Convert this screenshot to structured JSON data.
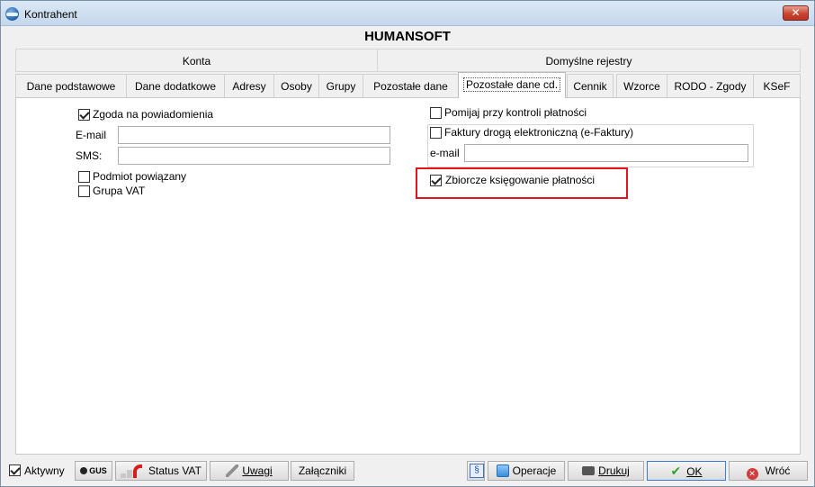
{
  "window": {
    "title": "Kontrahent",
    "close_label": "✕"
  },
  "company_name": "HUMANSOFT",
  "group_tabs": [
    "Konta",
    "Domyślne rejestry"
  ],
  "tabs": [
    "Dane podstawowe",
    "Dane dodatkowe",
    "Adresy",
    "Osoby",
    "Grupy",
    "Pozostałe dane",
    "Pozostałe dane cd.",
    "Cennik",
    "Wzorce",
    "RODO - Zgody",
    "KSeF"
  ],
  "active_tab": "Pozostałe dane cd.",
  "left": {
    "consent": {
      "label": "Zgoda na powiadomienia",
      "checked": true
    },
    "email_label": "E-mail",
    "email_value": "",
    "sms_label": "SMS:",
    "sms_value": "",
    "related_entity": {
      "label": "Podmiot powiązany",
      "checked": false
    },
    "vat_group": {
      "label": "Grupa VAT",
      "checked": false
    }
  },
  "right": {
    "skip_payment_control": {
      "label": "Pomijaj przy kontroli płatności",
      "checked": false
    },
    "e_invoices": {
      "label": "Faktury drogą elektroniczną (e-Faktury)",
      "checked": false
    },
    "einvoice_email_label": "e-mail",
    "einvoice_email_value": "",
    "collective_booking": {
      "label": "Zbiorcze księgowanie płatności",
      "checked": true
    }
  },
  "bottom": {
    "active": {
      "label": "Aktywny",
      "checked": true
    },
    "gus_label": "GUS",
    "status_vat_label": "Status VAT",
    "notes_label": "Uwagi",
    "attachments_label": "Załączniki",
    "calc_label": "§",
    "operations_label": "Operacje",
    "print_label": "Drukuj",
    "ok_label": "OK",
    "back_label": "Wróć"
  },
  "colors": {
    "highlight": "#e3161e",
    "panel": "#ffffff",
    "window": "#f0f0f0"
  }
}
